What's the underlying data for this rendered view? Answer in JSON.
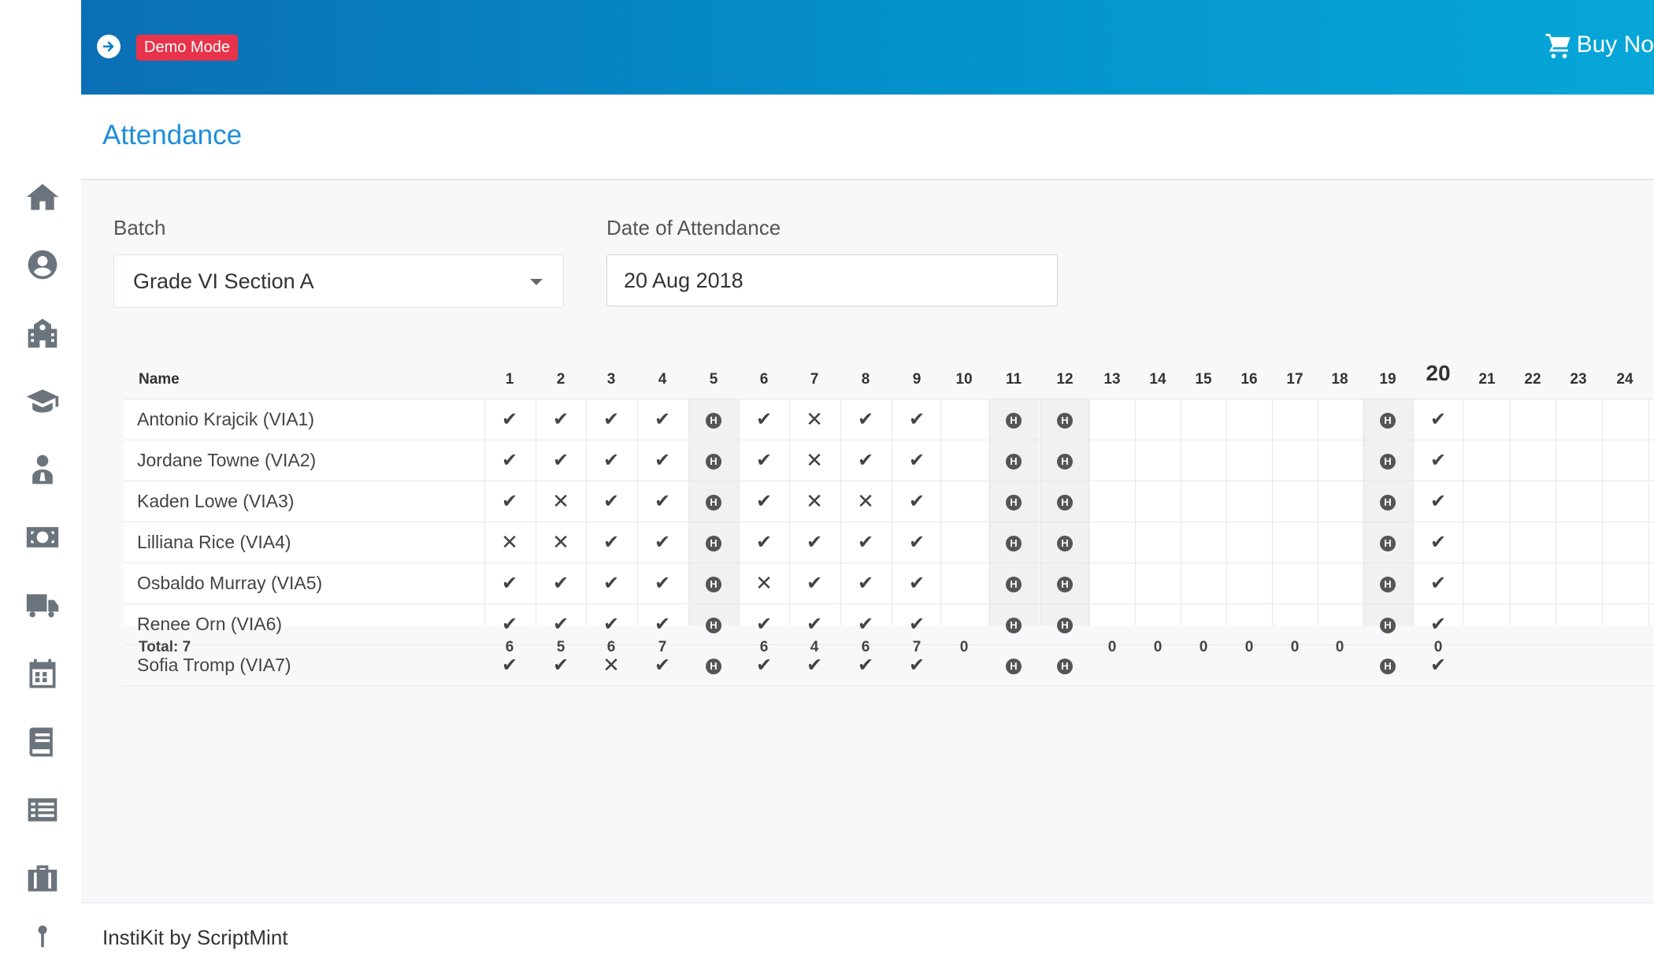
{
  "sidebar": {
    "items": [
      "home-icon",
      "user-circle-icon",
      "school-building-icon",
      "graduation-cap-icon",
      "teacher-icon",
      "money-icon",
      "truck-icon",
      "calendar-icon",
      "book-icon",
      "list-icon",
      "briefcase-icon",
      "more-icon"
    ]
  },
  "topbar": {
    "badge": "Demo Mode",
    "buy_label": "Buy No",
    "gradient_colors": [
      "#0b6fb5",
      "#07a6d8"
    ],
    "badge_color": "#e8334a"
  },
  "page": {
    "title": "Attendance"
  },
  "form": {
    "batch_label": "Batch",
    "batch_value": "Grade VI Section A",
    "date_label": "Date of Attendance",
    "date_value": "20 Aug 2018"
  },
  "table": {
    "name_header": "Name",
    "days": [
      "1",
      "2",
      "3",
      "4",
      "5",
      "6",
      "7",
      "8",
      "9",
      "10",
      "11",
      "12",
      "13",
      "14",
      "15",
      "16",
      "17",
      "18",
      "19",
      "20",
      "21",
      "22",
      "23",
      "24"
    ],
    "today": "20",
    "students": [
      {
        "name": "Antonio Krajcik (VIA1)",
        "marks": [
          "P",
          "P",
          "P",
          "P",
          "H",
          "P",
          "A",
          "P",
          "P",
          "",
          "H",
          "H",
          "",
          "",
          "",
          "",
          "",
          "",
          "H",
          "P",
          "",
          "",
          "",
          ""
        ]
      },
      {
        "name": "Jordane Towne (VIA2)",
        "marks": [
          "P",
          "P",
          "P",
          "P",
          "H",
          "P",
          "A",
          "P",
          "P",
          "",
          "H",
          "H",
          "",
          "",
          "",
          "",
          "",
          "",
          "H",
          "P",
          "",
          "",
          "",
          ""
        ]
      },
      {
        "name": "Kaden Lowe (VIA3)",
        "marks": [
          "P",
          "A",
          "P",
          "P",
          "H",
          "P",
          "A",
          "A",
          "P",
          "",
          "H",
          "H",
          "",
          "",
          "",
          "",
          "",
          "",
          "H",
          "P",
          "",
          "",
          "",
          ""
        ]
      },
      {
        "name": "Lilliana Rice (VIA4)",
        "marks": [
          "A",
          "A",
          "P",
          "P",
          "H",
          "P",
          "P",
          "P",
          "P",
          "",
          "H",
          "H",
          "",
          "",
          "",
          "",
          "",
          "",
          "H",
          "P",
          "",
          "",
          "",
          ""
        ]
      },
      {
        "name": "Osbaldo Murray (VIA5)",
        "marks": [
          "P",
          "P",
          "P",
          "P",
          "H",
          "A",
          "P",
          "P",
          "P",
          "",
          "H",
          "H",
          "",
          "",
          "",
          "",
          "",
          "",
          "H",
          "P",
          "",
          "",
          "",
          ""
        ]
      },
      {
        "name": "Renee Orn (VIA6)",
        "marks": [
          "P",
          "P",
          "P",
          "P",
          "H",
          "P",
          "P",
          "P",
          "P",
          "",
          "H",
          "H",
          "",
          "",
          "",
          "",
          "",
          "",
          "H",
          "P",
          "",
          "",
          "",
          ""
        ]
      },
      {
        "name": "Sofia Tromp (VIA7)",
        "marks": [
          "P",
          "P",
          "A",
          "P",
          "H",
          "P",
          "P",
          "P",
          "P",
          "",
          "H",
          "H",
          "",
          "",
          "",
          "",
          "",
          "",
          "H",
          "P",
          "",
          "",
          "",
          ""
        ]
      }
    ],
    "total_label": "Total: 7",
    "totals": [
      "6",
      "5",
      "6",
      "7",
      "",
      "6",
      "4",
      "6",
      "7",
      "0",
      "",
      "",
      "0",
      "0",
      "0",
      "0",
      "0",
      "0",
      "",
      "0",
      "",
      "",
      "",
      ""
    ],
    "mark_glyphs": {
      "P": "✔",
      "A": "✕",
      "H": "H"
    }
  },
  "footer": {
    "text": "InstiKit by ScriptMint"
  }
}
